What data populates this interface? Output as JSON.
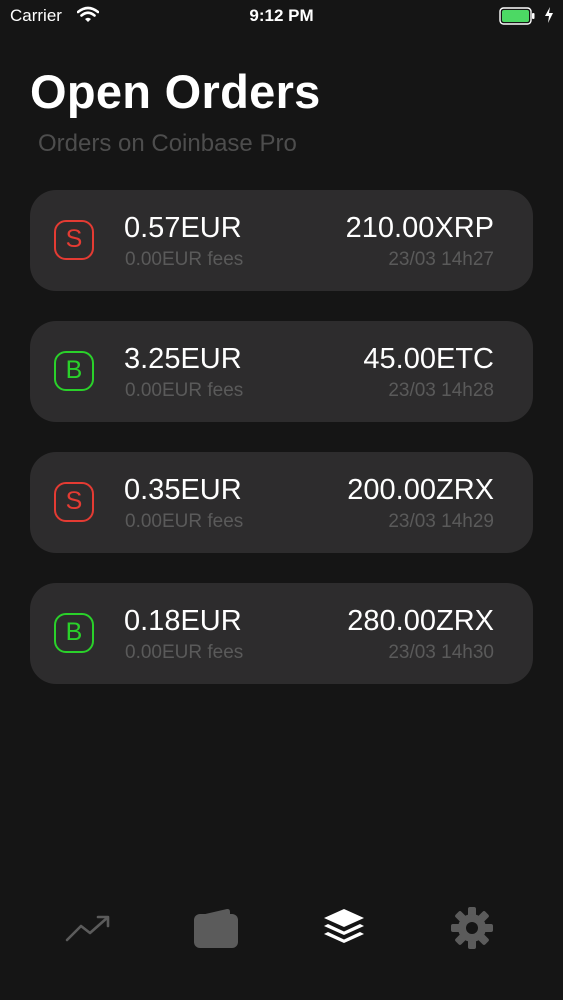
{
  "status_bar": {
    "carrier": "Carrier",
    "time": "9:12 PM"
  },
  "header": {
    "title": "Open Orders",
    "subtitle": "Orders on Coinbase Pro"
  },
  "orders": [
    {
      "side": "S",
      "side_color": "#e43b33",
      "amount": "0.57EUR",
      "fees": "0.00EUR fees",
      "quantity": "210.00XRP",
      "datetime": "23/03 14h27"
    },
    {
      "side": "B",
      "side_color": "#2ad12a",
      "amount": "3.25EUR",
      "fees": "0.00EUR fees",
      "quantity": "45.00ETC",
      "datetime": "23/03 14h28"
    },
    {
      "side": "S",
      "side_color": "#e43b33",
      "amount": "0.35EUR",
      "fees": "0.00EUR fees",
      "quantity": "200.00ZRX",
      "datetime": "23/03 14h29"
    },
    {
      "side": "B",
      "side_color": "#2ad12a",
      "amount": "0.18EUR",
      "fees": "0.00EUR fees",
      "quantity": "280.00ZRX",
      "datetime": "23/03 14h30"
    }
  ],
  "tab_bar": {
    "tabs": [
      {
        "icon": "chart-trend-icon",
        "active": false
      },
      {
        "icon": "wallet-icon",
        "active": false
      },
      {
        "icon": "layers-icon",
        "active": true
      },
      {
        "icon": "gear-icon",
        "active": false
      }
    ]
  },
  "colors": {
    "background": "#151515",
    "card": "#2d2c2d",
    "sell": "#e43b33",
    "buy": "#2ad12a",
    "muted_text": "#5a5a5a",
    "battery": "#4cd964",
    "inactive_tab": "#5b5b5b",
    "active_tab": "#ffffff"
  }
}
